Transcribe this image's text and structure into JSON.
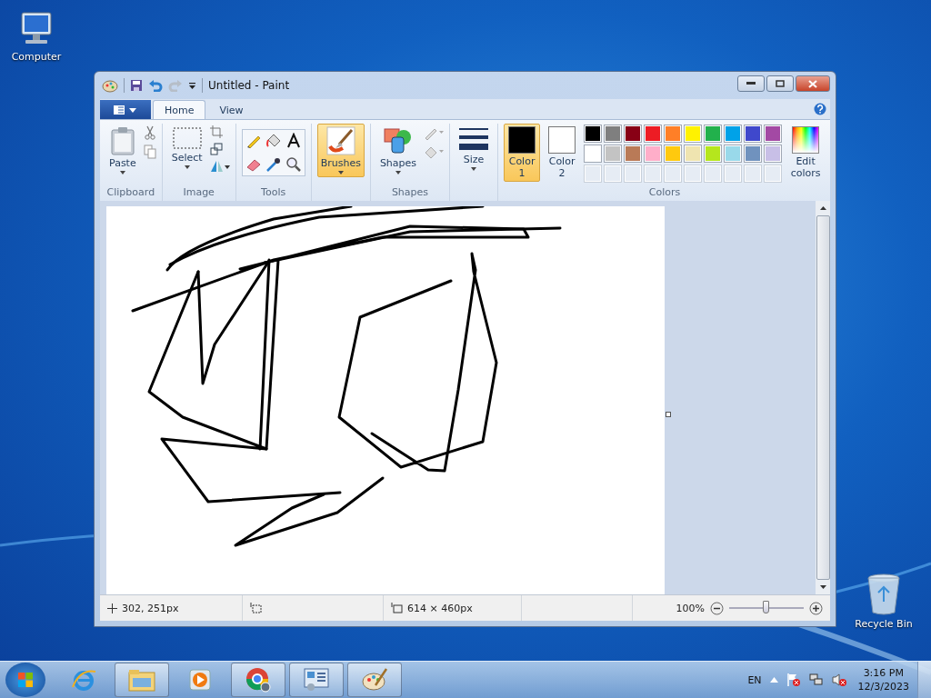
{
  "desktop_icons": [
    {
      "label": "Computer",
      "kind": "computer"
    },
    {
      "label": "Recycle Bin",
      "kind": "recycle"
    }
  ],
  "window": {
    "title": "Untitled - Paint"
  },
  "tabs": [
    {
      "label": "Home",
      "selected": true
    },
    {
      "label": "View",
      "selected": false
    }
  ],
  "ribbon": {
    "clipboard": {
      "group": "Clipboard",
      "paste": "Paste"
    },
    "image": {
      "group": "Image",
      "select": "Select"
    },
    "tools": {
      "group": "Tools"
    },
    "brushes": {
      "label": "Brushes",
      "selected": true
    },
    "shapes": {
      "group": "Shapes",
      "label": "Shapes"
    },
    "size": {
      "label": "Size"
    },
    "colors": {
      "group": "Colors",
      "color1": {
        "label": "Color 1",
        "color": "#000000",
        "selected": true
      },
      "color2": {
        "label": "Color 2",
        "color": "#ffffff",
        "selected": false
      },
      "palette": [
        {
          "color": "#000000"
        },
        {
          "color": "#7f7f7f"
        },
        {
          "color": "#880015"
        },
        {
          "color": "#ed1c24"
        },
        {
          "color": "#ff7f27"
        },
        {
          "color": "#fff200"
        },
        {
          "color": "#22b14c"
        },
        {
          "color": "#00a2e8"
        },
        {
          "color": "#3f48cc"
        },
        {
          "color": "#a349a4"
        },
        {
          "color": "#ffffff"
        },
        {
          "color": "#c3c3c3"
        },
        {
          "color": "#b97a57"
        },
        {
          "color": "#ffaec9"
        },
        {
          "color": "#ffc90e"
        },
        {
          "color": "#efe4b0"
        },
        {
          "color": "#b5e61d"
        },
        {
          "color": "#99d9ea"
        },
        {
          "color": "#7092be"
        },
        {
          "color": "#c8bfe7"
        }
      ],
      "edit": "Edit colors"
    }
  },
  "status_bar": {
    "position": "302, 251px",
    "canvas_size": "614 × 460px",
    "zoom": "100%",
    "zoom_slider": {
      "level": 0.5
    }
  },
  "taskbar": {
    "apps": [
      {
        "kind": "ie",
        "open": false
      },
      {
        "kind": "explorer",
        "open": true
      },
      {
        "kind": "media",
        "open": false
      },
      {
        "kind": "chrome",
        "open": true
      },
      {
        "kind": "panel",
        "open": true
      },
      {
        "kind": "paint",
        "open": true
      }
    ],
    "language": "EN",
    "time": "3:16 PM",
    "date": "12/3/2023"
  }
}
